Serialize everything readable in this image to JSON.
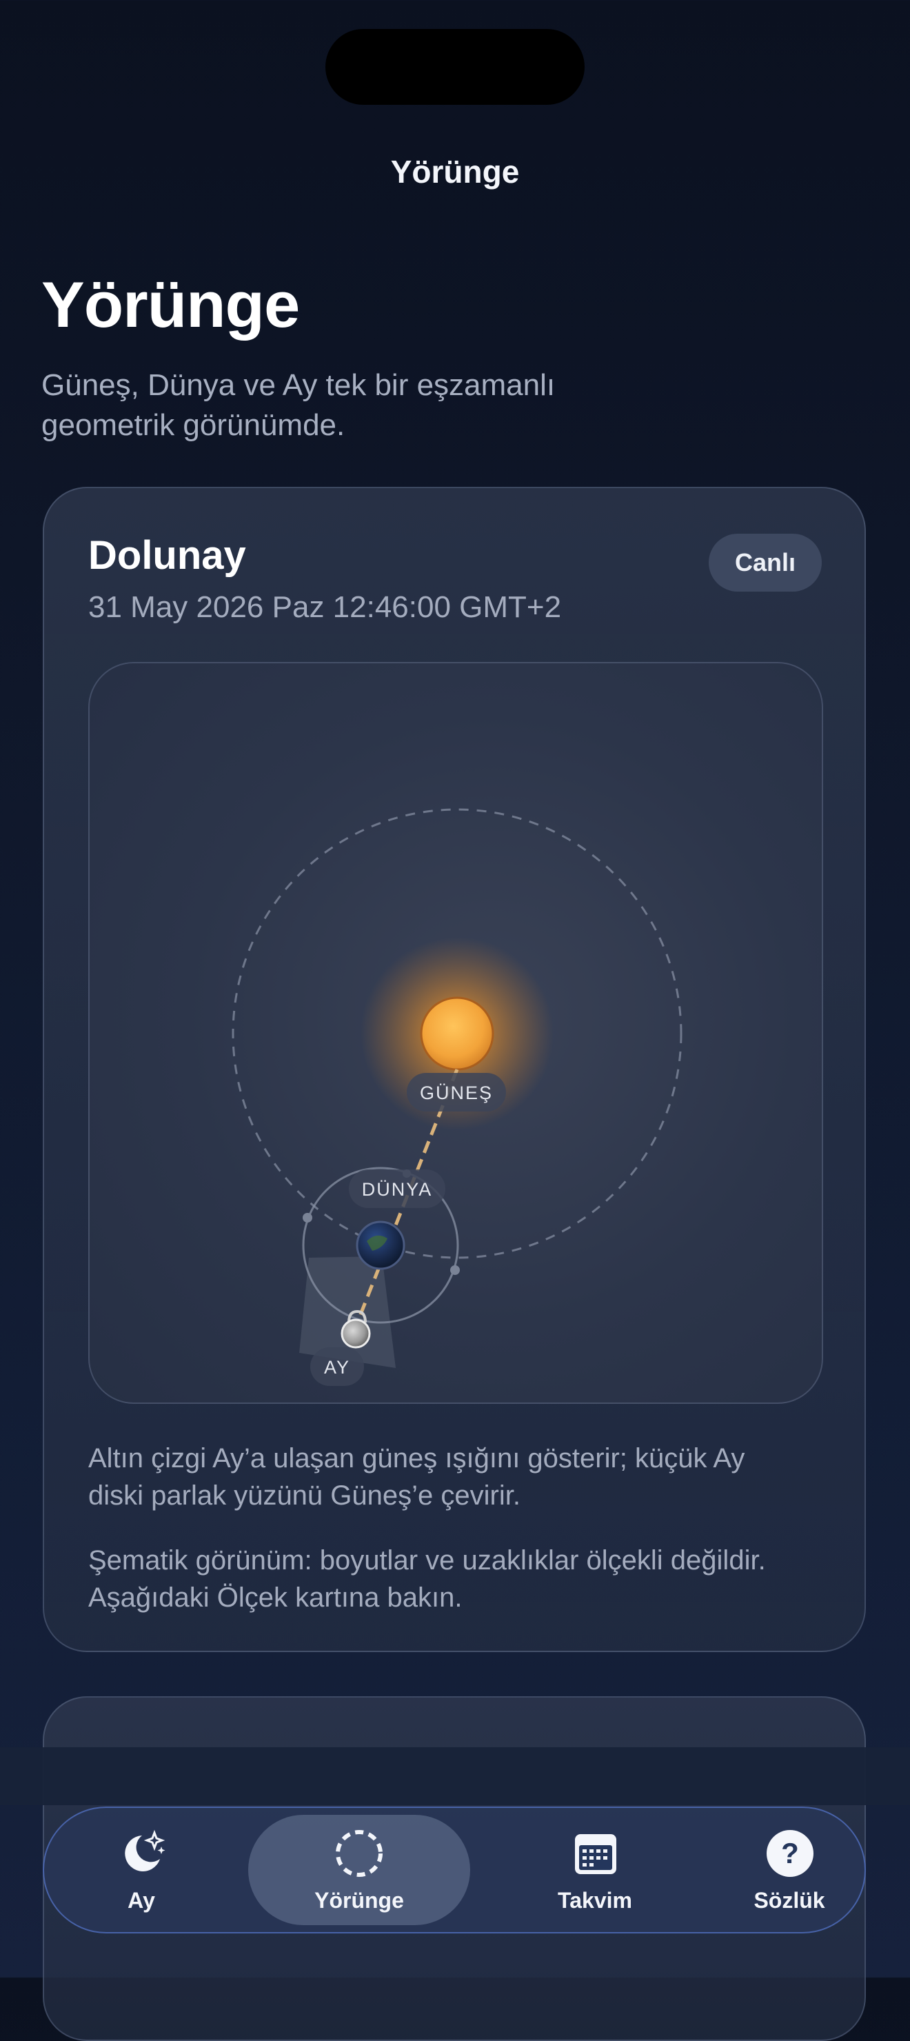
{
  "header": {
    "nav_title": "Yörünge"
  },
  "page": {
    "title": "Yörünge",
    "subtitle_line1": "Güneş, Dünya ve Ay tek bir eşzamanlı",
    "subtitle_line2": "geometrik görünümde."
  },
  "orbit_card": {
    "phase_name": "Dolunay",
    "date": "31 May 2026 Paz 12:46:00 GMT+2",
    "live_badge": "Canlı",
    "labels": {
      "sun": "GÜNEŞ",
      "earth": "DÜNYA",
      "moon": "AY"
    },
    "description_line1": "Altın çizgi Ay’a ulaşan güneş ışığını gösterir; küçük Ay",
    "description_line2": "diski parlak yüzünü Güneş’e çevirir.",
    "note_line1": "Şematik görünüm: boyutlar ve uzaklıklar ölçekli değildir.",
    "note_line2": "Aşağıdaki Ölçek kartına bakın."
  },
  "tabbar": {
    "tabs": [
      {
        "label": "Ay",
        "icon": "moon-stars-icon",
        "active": false
      },
      {
        "label": "Yörünge",
        "icon": "orbit-icon",
        "active": true
      },
      {
        "label": "Takvim",
        "icon": "calendar-icon",
        "active": false
      },
      {
        "label": "Sözlük",
        "icon": "question-icon",
        "active": false
      }
    ]
  },
  "colors": {
    "background": "#0f172a",
    "sun": "#f2a03a",
    "sunlight_line": "#d9b27a",
    "accent_border": "#5070c0"
  }
}
